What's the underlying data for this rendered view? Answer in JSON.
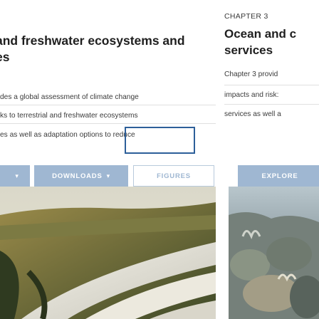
{
  "left_card": {
    "title_line1": "and freshwater ecosystems and",
    "title_line2": "es",
    "description_lines": [
      "des a global assessment of climate change",
      "ks to terrestrial and freshwater ecosystems",
      "es as well as adaptation options to reduce"
    ],
    "buttons": {
      "first_partial": "",
      "downloads": "DOWNLOADS",
      "figures": "FIGURES"
    },
    "image_alt": "river landscape aerial"
  },
  "right_card": {
    "chapter_label": "CHAPTER 3",
    "title_line1": "Ocean and c",
    "title_line2": "services",
    "description_lines": [
      "Chapter 3 provid",
      "impacts and risk:",
      "services as well a"
    ],
    "button_explore": "EXPLORE",
    "image_alt": "coral reef"
  },
  "colors": {
    "button_blue": "#9fb7d2",
    "focus_border": "#2d5f99"
  }
}
